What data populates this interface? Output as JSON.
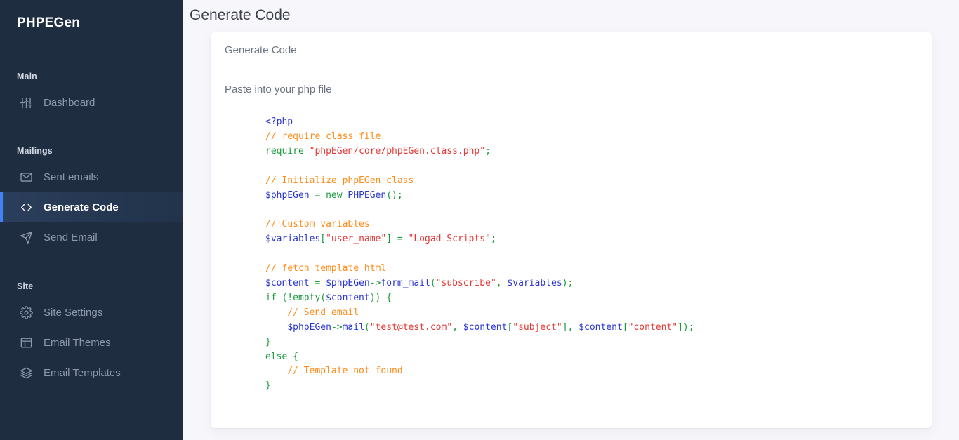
{
  "sidebar": {
    "brand": "PHPEGen",
    "sections": [
      {
        "label": "Main",
        "items": [
          {
            "label": "Dashboard",
            "icon": "sliders-icon",
            "active": false
          }
        ]
      },
      {
        "label": "Mailings",
        "items": [
          {
            "label": "Sent emails",
            "icon": "envelope-icon",
            "active": false
          },
          {
            "label": "Generate Code",
            "icon": "code-brackets-icon",
            "active": true
          },
          {
            "label": "Send Email",
            "icon": "paper-plane-icon",
            "active": false
          }
        ]
      },
      {
        "label": "Site",
        "items": [
          {
            "label": "Site Settings",
            "icon": "gear-icon",
            "active": false
          },
          {
            "label": "Email Themes",
            "icon": "layout-panel-icon",
            "active": false
          },
          {
            "label": "Email Templates",
            "icon": "layers-icon",
            "active": false
          }
        ]
      }
    ]
  },
  "header": {
    "title": "Generate Code"
  },
  "card": {
    "title": "Generate Code",
    "subtitle": "Paste into your php file",
    "code_plain": "<?php\n// require class file\nrequire \"phpEGen/core/phpEGen.class.php\";\n\n// Initialize phpEGen class\n$phpEGen = new PHPEGen();\n\n// Custom variables\n$variables[\"user_name\"] = \"Logad Scripts\";\n\n// fetch template html\n$content = $phpEGen->form_mail(\"subscribe\", $variables);\nif (!empty($content)) {\n    // Send email\n    $phpEGen->mail(\"test@test.com\", $content[\"subject\"], $content[\"content\"]);\n}\nelse {\n    // Template not found\n}",
    "code_lines": [
      [
        {
          "t": "<?php",
          "c": "tag"
        }
      ],
      [
        {
          "t": "// require class file",
          "c": "cm"
        }
      ],
      [
        {
          "t": "require ",
          "c": "kw"
        },
        {
          "t": "\"phpEGen/core/phpEGen.class.php\"",
          "c": "st"
        },
        {
          "t": ";",
          "c": "kw"
        }
      ],
      [
        {
          "t": "",
          "c": "t"
        }
      ],
      [
        {
          "t": "// Initialize phpEGen class",
          "c": "cm"
        }
      ],
      [
        {
          "t": "$phpEGen",
          "c": "va"
        },
        {
          "t": " = ",
          "c": "kw"
        },
        {
          "t": "new",
          "c": "kw"
        },
        {
          "t": " ",
          "c": "kw"
        },
        {
          "t": "PHPEGen",
          "c": "va"
        },
        {
          "t": "();",
          "c": "pn"
        }
      ],
      [
        {
          "t": "",
          "c": "t"
        }
      ],
      [
        {
          "t": "// Custom variables",
          "c": "cm"
        }
      ],
      [
        {
          "t": "$variables",
          "c": "va"
        },
        {
          "t": "[",
          "c": "pn"
        },
        {
          "t": "\"user_name\"",
          "c": "st"
        },
        {
          "t": "]",
          "c": "pn"
        },
        {
          "t": " = ",
          "c": "kw"
        },
        {
          "t": "\"Logad Scripts\"",
          "c": "st"
        },
        {
          "t": ";",
          "c": "kw"
        }
      ],
      [
        {
          "t": "",
          "c": "t"
        }
      ],
      [
        {
          "t": "// fetch template html",
          "c": "cm"
        }
      ],
      [
        {
          "t": "$content",
          "c": "va"
        },
        {
          "t": " = ",
          "c": "kw"
        },
        {
          "t": "$phpEGen",
          "c": "va"
        },
        {
          "t": "->",
          "c": "kw"
        },
        {
          "t": "form_mail",
          "c": "va"
        },
        {
          "t": "(",
          "c": "pn"
        },
        {
          "t": "\"subscribe\"",
          "c": "st"
        },
        {
          "t": ", ",
          "c": "kw"
        },
        {
          "t": "$variables",
          "c": "va"
        },
        {
          "t": ")",
          "c": "pn"
        },
        {
          "t": ";",
          "c": "kw"
        }
      ],
      [
        {
          "t": "if (!empty(",
          "c": "kw"
        },
        {
          "t": "$content",
          "c": "va"
        },
        {
          "t": ")) {",
          "c": "kw"
        }
      ],
      [
        {
          "t": "    ",
          "c": "t"
        },
        {
          "t": "// Send email",
          "c": "cm"
        }
      ],
      [
        {
          "t": "    ",
          "c": "t"
        },
        {
          "t": "$phpEGen",
          "c": "va"
        },
        {
          "t": "->",
          "c": "kw"
        },
        {
          "t": "mail",
          "c": "va"
        },
        {
          "t": "(",
          "c": "pn"
        },
        {
          "t": "\"test@test.com\"",
          "c": "st"
        },
        {
          "t": ", ",
          "c": "kw"
        },
        {
          "t": "$content",
          "c": "va"
        },
        {
          "t": "[",
          "c": "pn"
        },
        {
          "t": "\"subject\"",
          "c": "st"
        },
        {
          "t": "]",
          "c": "pn"
        },
        {
          "t": ", ",
          "c": "kw"
        },
        {
          "t": "$content",
          "c": "va"
        },
        {
          "t": "[",
          "c": "pn"
        },
        {
          "t": "\"content\"",
          "c": "st"
        },
        {
          "t": "]",
          "c": "pn"
        },
        {
          "t": ");",
          "c": "kw"
        }
      ],
      [
        {
          "t": "}",
          "c": "kw"
        }
      ],
      [
        {
          "t": "else {",
          "c": "kw"
        }
      ],
      [
        {
          "t": "    ",
          "c": "t"
        },
        {
          "t": "// Template not found",
          "c": "cm"
        }
      ],
      [
        {
          "t": "}",
          "c": "kw"
        }
      ]
    ]
  },
  "colors": {
    "sidebar_bg": "#1f2d40",
    "sidebar_active_bg": "#2b3e5c",
    "accent": "#3f83f8",
    "page_bg": "#f7f7fb",
    "card_bg": "#ffffff",
    "comment": "#ff8c1a",
    "string": "#e53935",
    "variable": "#2a35d6",
    "keyword": "#1a9a3c"
  }
}
